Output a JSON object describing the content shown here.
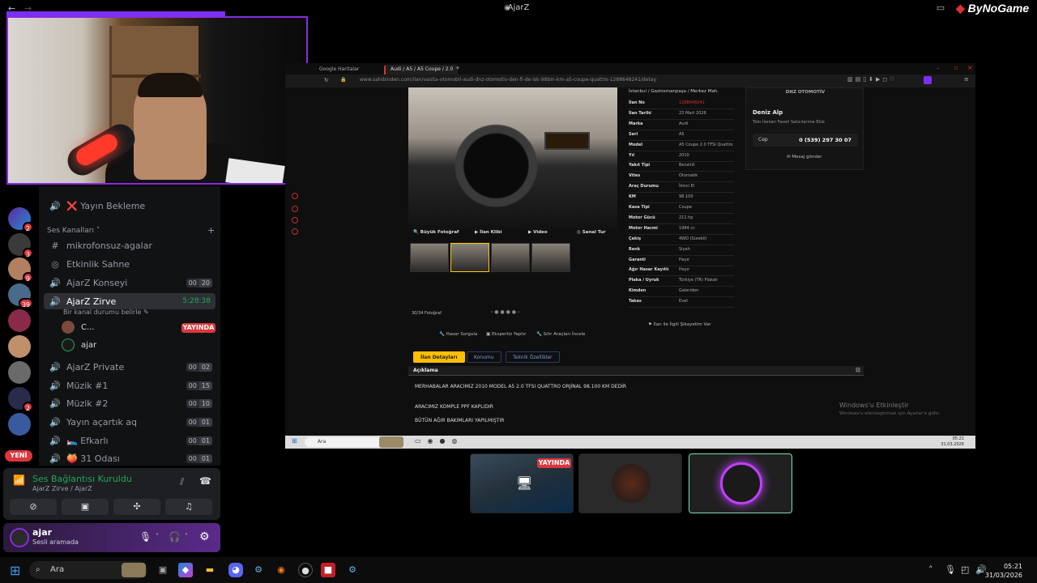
{
  "window": {
    "title": "AjarZ",
    "brand": "ByNoGame"
  },
  "discord": {
    "channels": [
      {
        "name": "Yayın Bekleme",
        "icon": "speaker-icon",
        "prefix": "❌"
      },
      {
        "name": "mikrofonsuz-agalar",
        "icon": "hash-icon"
      },
      {
        "name": "Etkinlik Sahne",
        "icon": "stage-icon"
      },
      {
        "name": "AjarZ Konseyi",
        "icon": "speaker-icon",
        "count": [
          "00",
          "20"
        ]
      },
      {
        "name": "AjarZ Zirve",
        "icon": "speaker-icon",
        "timer": "5:28:38",
        "topic": "Bir kanal durumu belirle"
      },
      {
        "name": "AjarZ Private",
        "icon": "speaker-icon",
        "count": [
          "00",
          "02"
        ]
      },
      {
        "name": "Müzik #1",
        "icon": "speaker-icon",
        "count": [
          "00",
          "15"
        ]
      },
      {
        "name": "Müzik #2",
        "icon": "speaker-icon",
        "count": [
          "00",
          "10"
        ]
      },
      {
        "name": "Yayın açartık aq",
        "icon": "speaker-icon",
        "count": [
          "00",
          "01"
        ]
      },
      {
        "name": "Efkarlı",
        "icon": "speaker-icon",
        "prefix": "🛌",
        "count": [
          "00",
          "01"
        ]
      },
      {
        "name": "31 Odası",
        "icon": "speaker-icon",
        "prefix": "🍑",
        "count": [
          "00",
          "01"
        ]
      }
    ],
    "category": "Ses Kanalları",
    "members": [
      {
        "name": "C...",
        "live": "YAYINDA"
      },
      {
        "name": "ajar"
      }
    ],
    "new_badge": "YENİ",
    "server_badges": [
      "2",
      "3",
      "9",
      "39",
      "2"
    ],
    "voice": {
      "status": "Ses Bağlantısı Kuruldu",
      "location": "AjarZ Zirve / AjarZ"
    },
    "user": {
      "name": "ajar",
      "status": "Sesli aramada"
    }
  },
  "browser": {
    "tabs": [
      "Google Haritalar",
      "Audi / A5 / A5 Coupe / 2.0"
    ],
    "url": "www.sahibinden.com/ilan/vasita-otomobil-audi-dnz-otomotiv-den-fi-de-lsk-98bin-km-a5-coupe-quattro-1288648241/detay",
    "breadcrumb": "İstanbul / Gaziosmanpaşa / Merkez Mah.",
    "photo_controls": [
      "Büyük Fotoğraf",
      "İlan Klibi",
      "Video",
      "Sanal Tur"
    ],
    "photo_count": "30/34 Fotoğraf",
    "specs": [
      {
        "k": "İlan No",
        "v": "1288648241"
      },
      {
        "k": "İlan Tarihi",
        "v": "23 Mart 2026"
      },
      {
        "k": "Marka",
        "v": "Audi"
      },
      {
        "k": "Seri",
        "v": "A5"
      },
      {
        "k": "Model",
        "v": "A5 Coupe 2.0 TFSI Quattro"
      },
      {
        "k": "Yıl",
        "v": "2010"
      },
      {
        "k": "Yakıt Tipi",
        "v": "Benzinli"
      },
      {
        "k": "Vites",
        "v": "Otomatik"
      },
      {
        "k": "Araç Durumu",
        "v": "İkinci El"
      },
      {
        "k": "KM",
        "v": "98.100"
      },
      {
        "k": "Kasa Tipi",
        "v": "Coupe"
      },
      {
        "k": "Motor Gücü",
        "v": "211 hp"
      },
      {
        "k": "Motor Hacmi",
        "v": "1984 cc"
      },
      {
        "k": "Çekiş",
        "v": "4WD (Sürekli)"
      },
      {
        "k": "Renk",
        "v": "Siyah"
      },
      {
        "k": "Garanti",
        "v": "Hayır"
      },
      {
        "k": "Ağır Hasar Kayıtlı",
        "v": "Hayır"
      },
      {
        "k": "Plaka / Uyruk",
        "v": "Türkiye (TR) Plakalı"
      },
      {
        "k": "Kimden",
        "v": "Galeriden"
      },
      {
        "k": "Takas",
        "v": "Evet"
      }
    ],
    "seller": {
      "firm": "DNZ OTOMOTİV",
      "name": "Deniz Alp",
      "links": "Tüm İlanları   Favori Satıcılarıma Ekle",
      "phone_label": "Cep",
      "phone": "0 (539) 297 30 07",
      "message": "Mesaj gönder"
    },
    "actions": [
      "Hasar Sorgula",
      "Ekspertiz Yaptır",
      "Sıfır Araçları İncele"
    ],
    "report": "İlan ile İlgili Şikayetim Var",
    "page_tabs": [
      "İlan Detayları",
      "Konumu",
      "Teknik Özellikler"
    ],
    "desc_title": "Açıklama",
    "desc_lines": [
      "MERHABALAR ARACIMIZ 2010 MODEL A5 2.0 TFSI QUATTRO ORJİNAL 98.100 KM DEDİR",
      "ARACIMIZ KOMPLE PPF KAPLIDIR",
      "BÜTÜN AĞIR BAKIMLARI YAPILMIŞTIR"
    ],
    "windows_activation": {
      "title": "Windows'u Etkinleştir",
      "sub": "Windows'u etkinleştirmek için Ayarlar'a gidin."
    },
    "inner_taskbar": {
      "search": "Ara",
      "time": "05:21",
      "date": "31.03.2026"
    }
  },
  "previews": {
    "live": "YAYINDA"
  },
  "taskbar": {
    "search": "Ara",
    "time": "05:21",
    "date": "31/03/2026"
  },
  "colors": {
    "accent": "#8a2be2",
    "live": "#da373c",
    "connected": "#23a55a",
    "yellow": "#ffc000"
  }
}
